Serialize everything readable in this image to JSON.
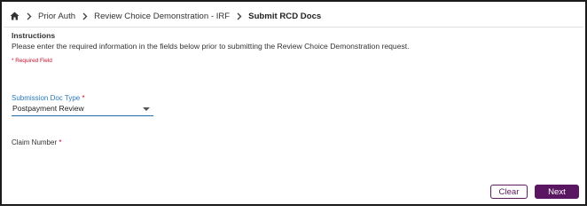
{
  "breadcrumb": {
    "items": [
      "Prior Auth",
      "Review Choice Demonstration - IRF"
    ],
    "current": "Submit RCD Docs"
  },
  "instructions": {
    "title": "Instructions",
    "text": "Please enter the required information in the fields below prior to submitting the Review Choice Demonstration request."
  },
  "required_note": "* Required Field",
  "form": {
    "submission_doc_type": {
      "label": "Submission Doc Type",
      "required_marker": "*",
      "value": "Postpayment Review"
    },
    "claim_number": {
      "label": "Claim Number",
      "required_marker": "*",
      "value": ""
    }
  },
  "buttons": {
    "clear": "Clear",
    "next": "Next"
  },
  "colors": {
    "accent_purple": "#5a1660",
    "required_red": "#c8102e",
    "field_blue": "#1f6fb0"
  },
  "icons": {
    "home": "home-icon",
    "separator": "chevron-right-icon",
    "dropdown": "caret-down-icon"
  }
}
